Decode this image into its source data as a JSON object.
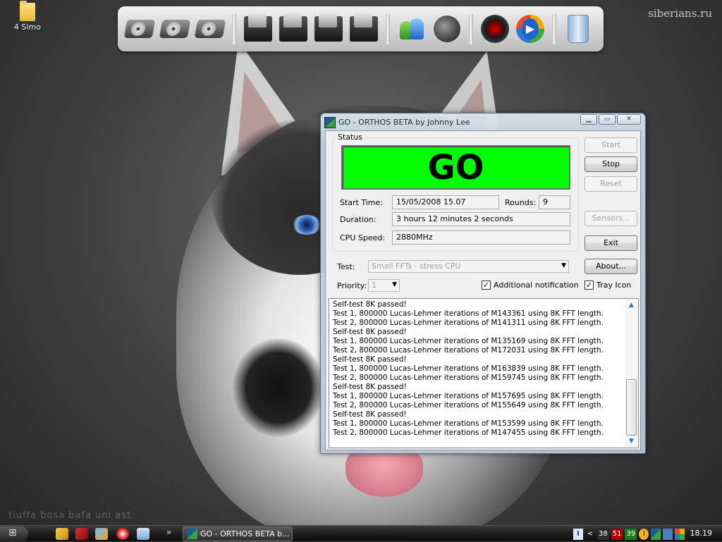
{
  "desktop": {
    "watermark": "siberians.ru",
    "folder_label": "4 Simo",
    "faint_text": "tiuffa bosa bafa unl ast"
  },
  "dock": {
    "items": [
      "drive-c-icon",
      "drive-d-icon",
      "drive-e-icon",
      "documents-folder-icon",
      "pictures-folder-icon",
      "music-folder-icon",
      "video-folder-icon",
      "msn-messenger-icon",
      "firefox-icon",
      "media-disc-icon",
      "windows-media-player-icon",
      "recycle-bin-icon"
    ]
  },
  "window": {
    "title": "GO - ORTHOS BETA by Johnny Lee",
    "status_group_label": "Status",
    "status_text": "GO",
    "status_color": "#00ff00",
    "start_time_label": "Start Time:",
    "start_time_value": "15/05/2008 15.07",
    "rounds_label": "Rounds:",
    "rounds_value": "9",
    "duration_label": "Duration:",
    "duration_value": "3 hours 12 minutes 2 seconds",
    "cpu_speed_label": "CPU Speed:",
    "cpu_speed_value": "2880MHz",
    "test_label": "Test:",
    "test_value": "Small FFTs - stress CPU",
    "priority_label": "Priority:",
    "priority_value": "1",
    "additional_notification_label": "Additional notification",
    "additional_notification_checked": true,
    "tray_icon_label": "Tray Icon",
    "tray_icon_checked": true,
    "buttons": {
      "start": "Start",
      "stop": "Stop",
      "reset": "Reset",
      "sensors": "Sensors...",
      "exit": "Exit",
      "about": "About..."
    },
    "log": [
      "Self-test 8K passed!",
      "Test 1, 800000 Lucas-Lehmer iterations of M143361 using 8K FFT length.",
      "Test 2, 800000 Lucas-Lehmer iterations of M141311 using 8K FFT length.",
      "Self-test 8K passed!",
      "Test 1, 800000 Lucas-Lehmer iterations of M135169 using 8K FFT length.",
      "Test 2, 800000 Lucas-Lehmer iterations of M172031 using 8K FFT length.",
      "Self-test 8K passed!",
      "Test 1, 800000 Lucas-Lehmer iterations of M163839 using 8K FFT length.",
      "Test 2, 800000 Lucas-Lehmer iterations of M159745 using 8K FFT length.",
      "Self-test 8K passed!",
      "Test 1, 800000 Lucas-Lehmer iterations of M157695 using 8K FFT length.",
      "Test 2, 800000 Lucas-Lehmer iterations of M155649 using 8K FFT length.",
      "Self-test 8K passed!",
      "Test 1, 800000 Lucas-Lehmer iterations of M153599 using 8K FFT length.",
      "Test 2, 800000 Lucas-Lehmer iterations of M147455 using 8K FFT length."
    ]
  },
  "taskbar": {
    "task_button_label": "GO - ORTHOS BETA b...",
    "chevron": "»",
    "tray_lang": "I",
    "tray_arrow": "<",
    "temps": [
      {
        "value": "38",
        "color": "#2a2a2a"
      },
      {
        "value": "51",
        "color": "#b00000"
      },
      {
        "value": "39",
        "color": "#1f7a1f"
      }
    ],
    "clock": "18.19"
  }
}
